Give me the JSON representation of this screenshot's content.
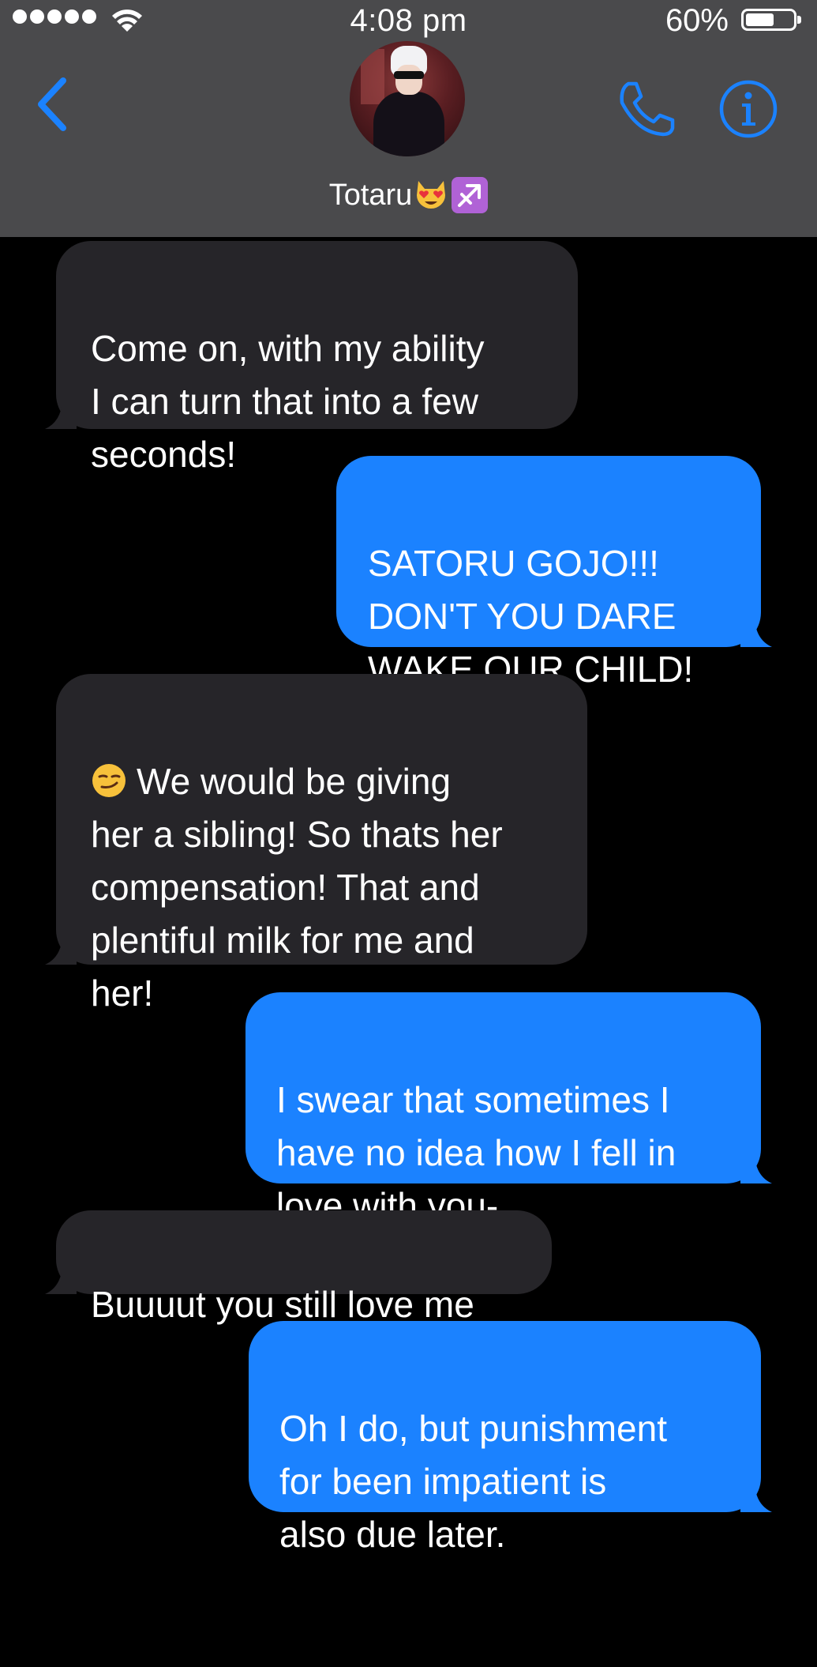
{
  "status_bar": {
    "time": "4:08 pm",
    "battery_percent_label": "60%",
    "battery_level": 0.6,
    "signal_bars": 5
  },
  "header": {
    "back_icon": "chevron-left-icon",
    "contact_name": "Totaru",
    "contact_emojis": [
      "smiling-cat-heart-eyes-emoji",
      "sagittarius-emoji"
    ],
    "call_icon": "phone-icon",
    "info_icon": "info-icon",
    "accent_color": "#1b82ff"
  },
  "messages": [
    {
      "direction": "incoming",
      "text": "Come on, with my ability\nI can turn that into a few\nseconds!"
    },
    {
      "direction": "outgoing",
      "text": "SATORU GOJO!!!\nDON'T YOU DARE\nWAKE OUR CHILD!"
    },
    {
      "direction": "incoming",
      "emoji": "smirking-face-emoji",
      "text": "We would be giving\nher a sibling! So thats her\ncompensation! That and\nplentiful milk for me and\nher!"
    },
    {
      "direction": "outgoing",
      "text": "I swear that sometimes I\nhave no idea how I fell in\nlove with you-"
    },
    {
      "direction": "incoming",
      "text": "Buuuut you still love me"
    },
    {
      "direction": "outgoing",
      "text": "Oh I do, but punishment\nfor been impatient is\nalso due later."
    }
  ],
  "colors": {
    "header_bg": "#4a4a4c",
    "thread_bg": "#000000",
    "incoming_bubble": "#262529",
    "outgoing_bubble": "#1b82ff"
  }
}
